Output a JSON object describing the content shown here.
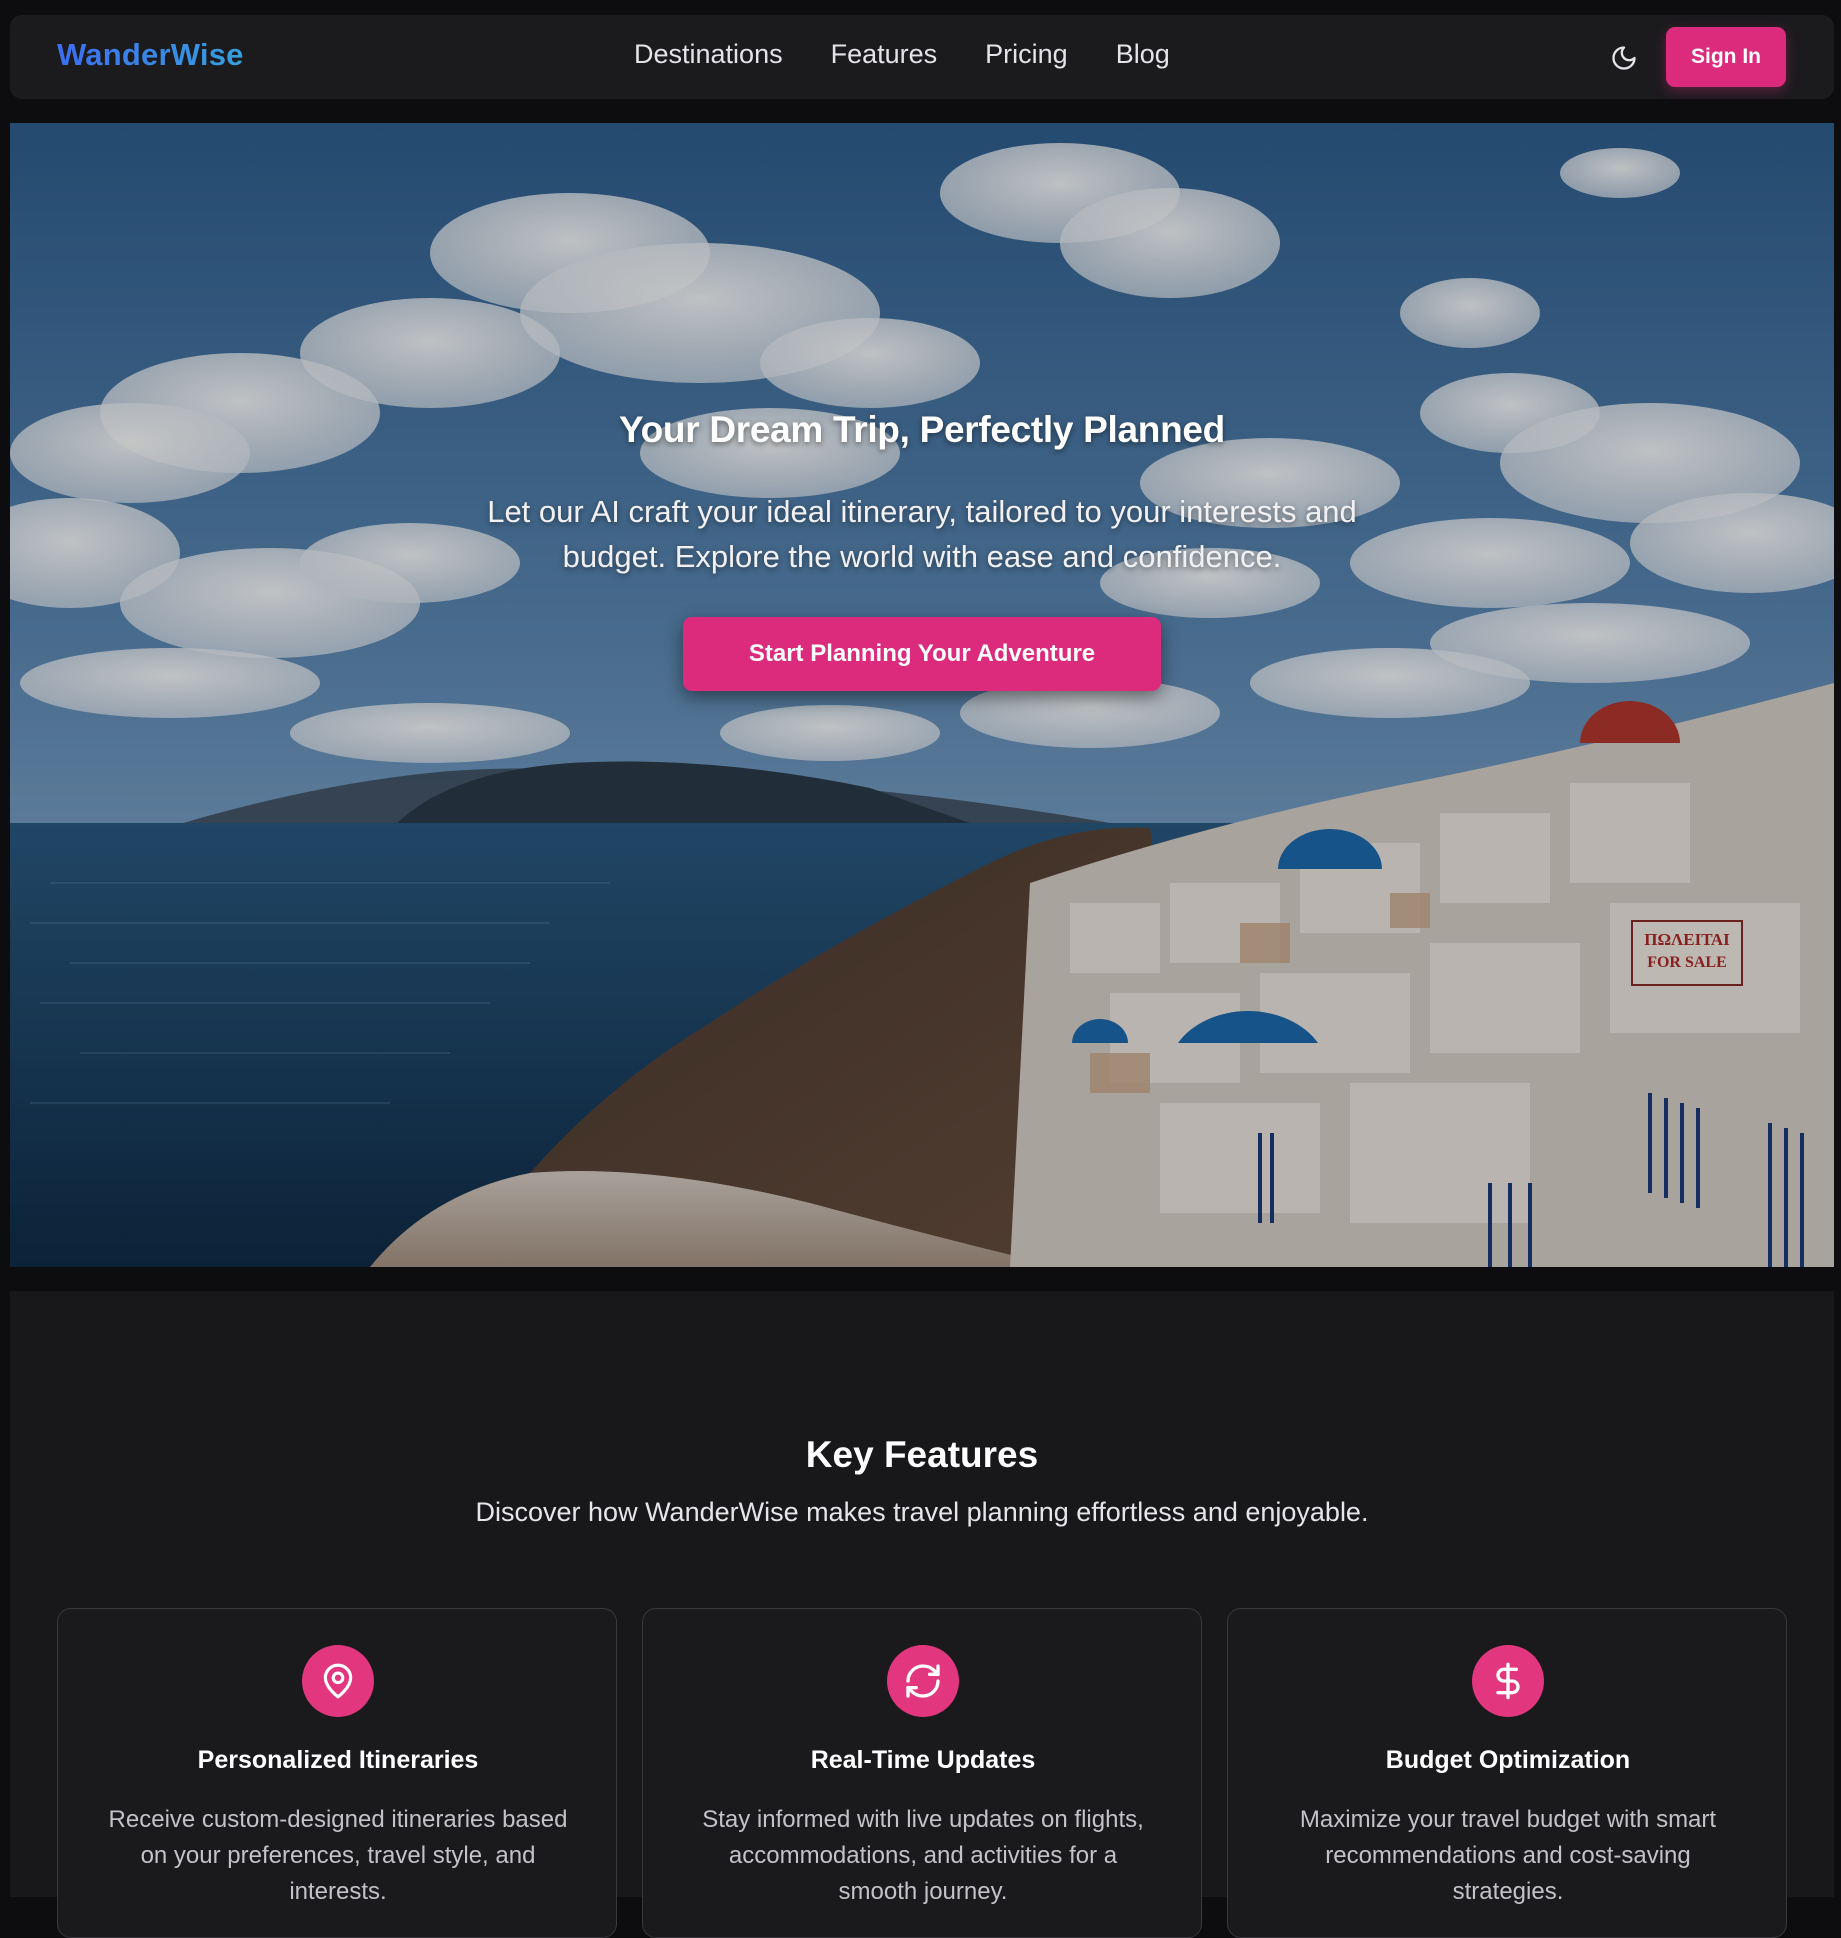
{
  "brand": {
    "name": "WanderWise"
  },
  "nav": {
    "links": [
      {
        "label": "Destinations"
      },
      {
        "label": "Features"
      },
      {
        "label": "Pricing"
      },
      {
        "label": "Blog"
      }
    ],
    "theme_toggle_icon": "moon-icon",
    "signin_label": "Sign In"
  },
  "hero": {
    "title": "Your Dream Trip, Perfectly Planned",
    "subtitle": "Let our AI craft your ideal itinerary, tailored to your interests and budget. Explore the world with ease and confidence.",
    "cta_label": "Start Planning Your Adventure",
    "sign_text_1": "ΠΩΛΕΙΤΑΙ",
    "sign_text_2": "FOR SALE"
  },
  "features": {
    "title": "Key Features",
    "subtitle": "Discover how WanderWise makes travel planning effortless and enjoyable.",
    "cards": [
      {
        "icon": "map-pin-icon",
        "title": "Personalized Itineraries",
        "description": "Receive custom-designed itineraries based on your preferences, travel style, and interests."
      },
      {
        "icon": "refresh-icon",
        "title": "Real-Time Updates",
        "description": "Stay informed with live updates on flights, accommodations, and activities for a smooth journey."
      },
      {
        "icon": "dollar-icon",
        "title": "Budget Optimization",
        "description": "Maximize your travel budget with smart recommendations and cost-saving strategies."
      }
    ]
  },
  "colors": {
    "accent": "#dc2a7c",
    "background": "#0d0d0f",
    "surface": "#1b1b1e",
    "logo_gradient_start": "#3d6ef0",
    "logo_gradient_end": "#36a0dc"
  }
}
